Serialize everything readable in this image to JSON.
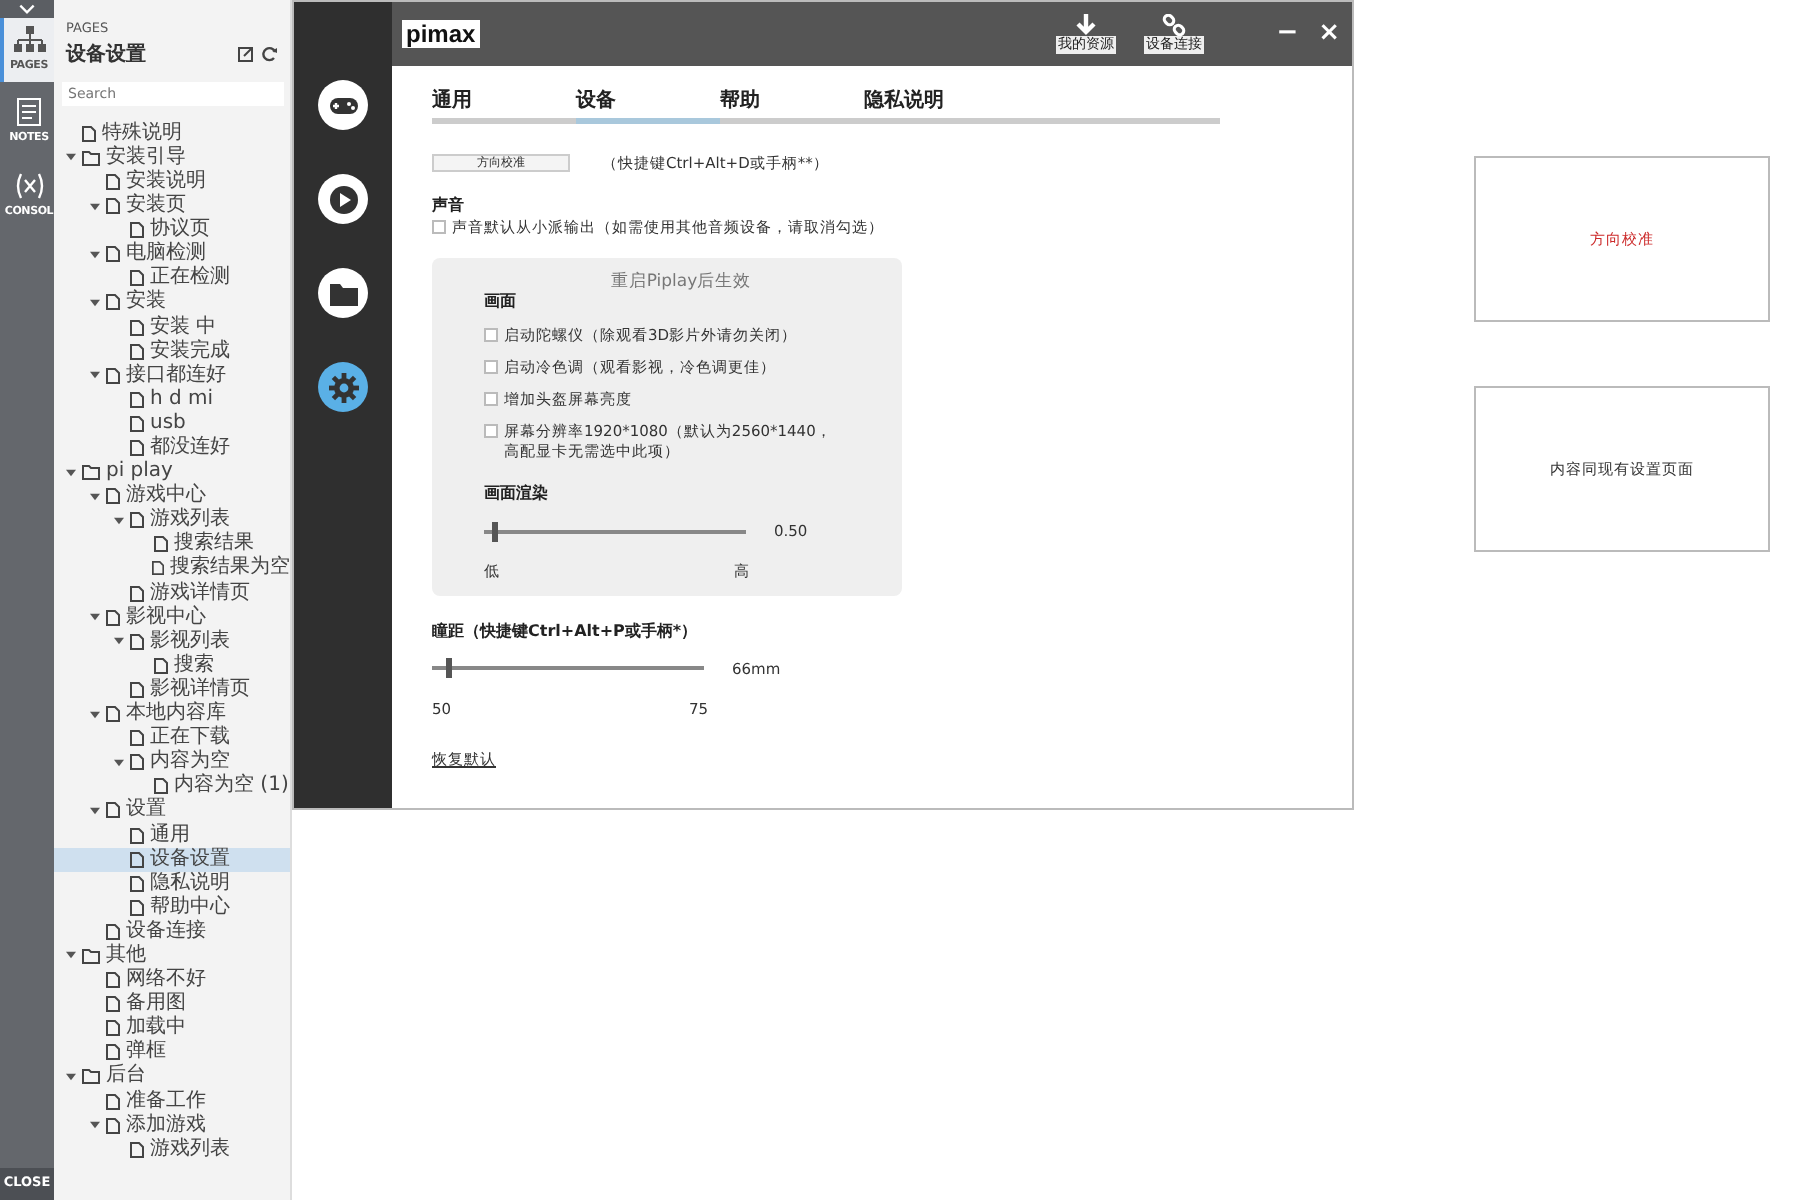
{
  "rail": {
    "tabs": [
      {
        "label": "PAGES",
        "kind": "sitemap",
        "selected": true
      },
      {
        "label": "NOTES",
        "kind": "notes",
        "selected": false
      },
      {
        "label": "CONSOL",
        "kind": "variable",
        "selected": false
      }
    ],
    "close": "CLOSE"
  },
  "pages_panel": {
    "heading": "PAGES",
    "title": "设备设置",
    "search": {
      "placeholder": "Search"
    },
    "tree": [
      {
        "label": "特殊说明",
        "kind": "page",
        "selected": false
      },
      {
        "label": "安装引导",
        "kind": "folder",
        "selected": false,
        "expanded": true,
        "children": [
          {
            "label": "安装说明",
            "kind": "page",
            "selected": false
          },
          {
            "label": "安装页",
            "kind": "page",
            "selected": false,
            "expanded": true,
            "children": [
              {
                "label": "协议页",
                "kind": "page",
                "selected": false
              }
            ]
          },
          {
            "label": "电脑检测",
            "kind": "page",
            "selected": false,
            "expanded": true,
            "children": [
              {
                "label": "正在检测",
                "kind": "page",
                "selected": false
              }
            ]
          },
          {
            "label": "安装",
            "kind": "page",
            "selected": false,
            "expanded": true,
            "children": [
              {
                "label": "安装 中",
                "kind": "page",
                "selected": false
              },
              {
                "label": "安装完成",
                "kind": "page",
                "selected": false
              }
            ]
          },
          {
            "label": "接口都连好",
            "kind": "page",
            "selected": false,
            "expanded": true,
            "children": [
              {
                "label": "h d mi",
                "kind": "page",
                "selected": false
              },
              {
                "label": "usb",
                "kind": "page",
                "selected": false
              },
              {
                "label": "都没连好",
                "kind": "page",
                "selected": false
              }
            ]
          }
        ]
      },
      {
        "label": "pi play",
        "kind": "folder",
        "selected": false,
        "expanded": true,
        "children": [
          {
            "label": "游戏中心",
            "kind": "page",
            "selected": false,
            "expanded": true,
            "children": [
              {
                "label": "游戏列表",
                "kind": "page",
                "selected": false,
                "expanded": true,
                "children": [
                  {
                    "label": "搜索结果",
                    "kind": "page",
                    "selected": false
                  },
                  {
                    "label": "搜索结果为空",
                    "kind": "page",
                    "selected": false
                  }
                ]
              },
              {
                "label": "游戏详情页",
                "kind": "page",
                "selected": false
              }
            ]
          },
          {
            "label": "影视中心",
            "kind": "page",
            "selected": false,
            "expanded": true,
            "children": [
              {
                "label": "影视列表",
                "kind": "page",
                "selected": false,
                "expanded": true,
                "children": [
                  {
                    "label": "搜索",
                    "kind": "page",
                    "selected": false
                  }
                ]
              },
              {
                "label": "影视详情页",
                "kind": "page",
                "selected": false
              }
            ]
          },
          {
            "label": "本地内容库",
            "kind": "page",
            "selected": false,
            "expanded": true,
            "children": [
              {
                "label": "正在下载",
                "kind": "page",
                "selected": false
              },
              {
                "label": "内容为空",
                "kind": "page",
                "selected": false,
                "expanded": true,
                "children": [
                  {
                    "label": "内容为空 (1)",
                    "kind": "page",
                    "selected": false
                  }
                ]
              }
            ]
          },
          {
            "label": "设置",
            "kind": "page",
            "selected": false,
            "expanded": true,
            "children": [
              {
                "label": "通用",
                "kind": "page",
                "selected": false
              },
              {
                "label": "设备设置",
                "kind": "page",
                "selected": true
              },
              {
                "label": "隐私说明",
                "kind": "page",
                "selected": false
              },
              {
                "label": "帮助中心",
                "kind": "page",
                "selected": false
              }
            ]
          },
          {
            "label": "设备连接",
            "kind": "page",
            "selected": false
          }
        ]
      },
      {
        "label": "其他",
        "kind": "folder",
        "selected": false,
        "expanded": true,
        "children": [
          {
            "label": "网络不好",
            "kind": "page",
            "selected": false
          },
          {
            "label": "备用图",
            "kind": "page",
            "selected": false
          },
          {
            "label": "加载中",
            "kind": "page",
            "selected": false
          },
          {
            "label": "弹框",
            "kind": "page",
            "selected": false
          }
        ]
      },
      {
        "label": "后台",
        "kind": "folder",
        "selected": false,
        "expanded": true,
        "children": [
          {
            "label": "准备工作",
            "kind": "page",
            "selected": false
          },
          {
            "label": "添加游戏",
            "kind": "page",
            "selected": false,
            "expanded": true,
            "children": [
              {
                "label": "游戏列表",
                "kind": "page",
                "selected": false
              }
            ]
          }
        ]
      }
    ]
  },
  "app": {
    "logo": "pimax",
    "header_actions": [
      {
        "label": "我的资源",
        "kind": "download"
      },
      {
        "label": "设备连接",
        "kind": "link"
      }
    ],
    "window_controls": [
      "−",
      "×"
    ],
    "nav": [
      {
        "kind": "gamepad",
        "selected": false
      },
      {
        "kind": "play",
        "selected": false
      },
      {
        "kind": "folder",
        "selected": false
      },
      {
        "kind": "gear",
        "selected": true
      }
    ],
    "tabs": [
      {
        "label": "通用",
        "selected": false
      },
      {
        "label": "设备",
        "selected": true
      },
      {
        "label": "帮助",
        "selected": false
      },
      {
        "label": "隐私说明",
        "selected": false
      }
    ],
    "calibrate_button": "方向校准",
    "calibrate_hint": "（快捷键Ctrl+Alt+D或手柄**）",
    "sound": {
      "heading": "声音",
      "option": {
        "label": "声音默认从小派输出（如需使用其他音频设备，请取消勾选）",
        "checked": false
      }
    },
    "display_panel": {
      "notice": "重启Piplay后生效",
      "heading": "画面",
      "options": [
        {
          "label": "启动陀螺仪（除观看3D影片外请勿关闭）",
          "checked": false
        },
        {
          "label": "启动冷色调（观看影视，冷色调更佳）",
          "checked": false
        },
        {
          "label": "增加头盔屏幕亮度",
          "checked": false
        },
        {
          "label": "屏幕分辨率1920*1080（默认为2560*1440，高配显卡无需选中此项）",
          "checked": false
        }
      ],
      "render": {
        "heading": "画面渲染",
        "level": 0.04,
        "reading": "0.50",
        "min_label": "低",
        "max_label": "高"
      }
    },
    "ipd": {
      "heading": "瞳距（快捷键Ctrl+Alt+P或手柄*）",
      "level": 0.06,
      "reading": "66mm",
      "min_label": "50",
      "max_label": "75"
    },
    "reset_link": "恢复默认"
  },
  "annotations": [
    {
      "text": "方向校准",
      "color": "#cc2b2b"
    },
    {
      "text": "内容同现有设置页面",
      "color": "#333333"
    }
  ]
}
